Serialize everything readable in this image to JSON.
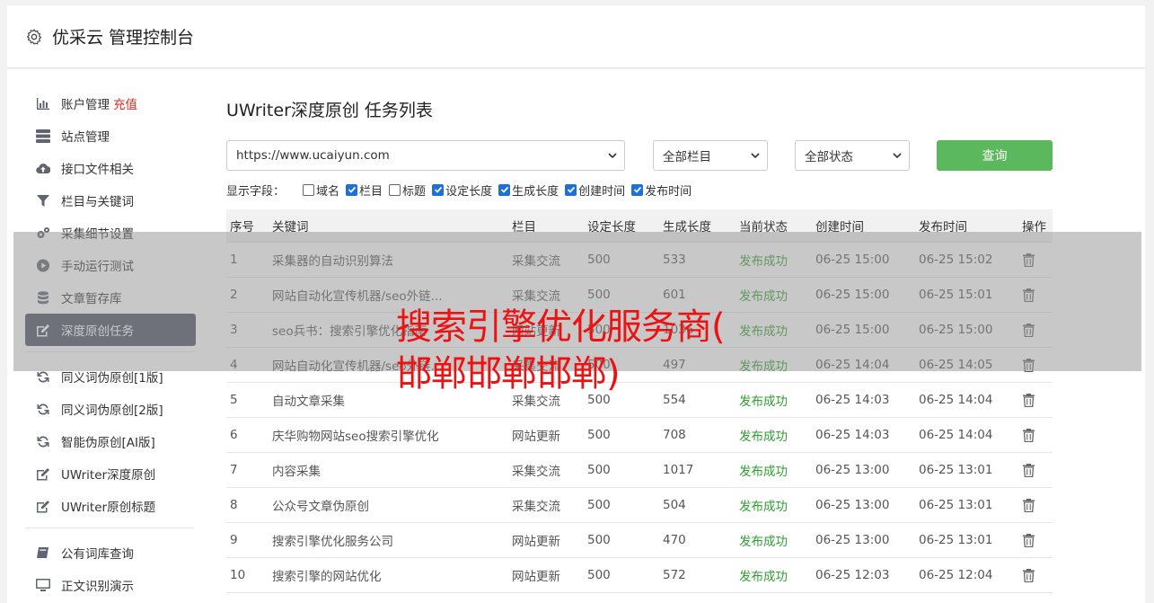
{
  "header": {
    "title": "优采云 管理控制台",
    "icon": "gear-icon"
  },
  "sidebar": {
    "group1": [
      {
        "label": "账户管理",
        "extra": "充值",
        "icon": "bar-chart-icon"
      },
      {
        "label": "站点管理",
        "icon": "server-icon"
      },
      {
        "label": "接口文件相关",
        "icon": "cloud-upload-icon"
      },
      {
        "label": "栏目与关键词",
        "icon": "filter-icon"
      },
      {
        "label": "采集细节设置",
        "icon": "gears-icon"
      },
      {
        "label": "手动运行测试",
        "icon": "play-circle-icon"
      },
      {
        "label": "文章暂存库",
        "icon": "database-icon"
      },
      {
        "label": "深度原创任务",
        "icon": "edit-icon",
        "active": true
      }
    ],
    "group2": [
      {
        "label": "同义词伪原创[1版]",
        "icon": "refresh-icon"
      },
      {
        "label": "同义词伪原创[2版]",
        "icon": "refresh-icon"
      },
      {
        "label": "智能伪原创[AI版]",
        "icon": "refresh-icon"
      },
      {
        "label": "UWriter深度原创",
        "icon": "edit-icon"
      },
      {
        "label": "UWriter原创标题",
        "icon": "edit-icon"
      }
    ],
    "group3": [
      {
        "label": "公有词库查询",
        "icon": "book-icon"
      },
      {
        "label": "正文识别演示",
        "icon": "monitor-icon"
      }
    ]
  },
  "main": {
    "title": "UWriter深度原创 任务列表",
    "site_select": "https://www.ucaiyun.com",
    "column_select": "全部栏目",
    "status_select": "全部状态",
    "query_button": "查询",
    "fields_label": "显示字段：",
    "fields": [
      {
        "label": "域名",
        "checked": false
      },
      {
        "label": "栏目",
        "checked": true
      },
      {
        "label": "标题",
        "checked": false
      },
      {
        "label": "设定长度",
        "checked": true
      },
      {
        "label": "生成长度",
        "checked": true
      },
      {
        "label": "创建时间",
        "checked": true
      },
      {
        "label": "发布时间",
        "checked": true
      }
    ],
    "columns": [
      "序号",
      "关键词",
      "栏目",
      "设定长度",
      "生成长度",
      "当前状态",
      "创建时间",
      "发布时间",
      "操作"
    ],
    "rows": [
      [
        "1",
        "采集器的自动识别算法",
        "采集交流",
        "500",
        "533",
        "发布成功",
        "06-25 15:00",
        "06-25 15:02"
      ],
      [
        "2",
        "网站自动化宣传机器/seo外链...",
        "采集交流",
        "500",
        "601",
        "发布成功",
        "06-25 15:00",
        "06-25 15:01"
      ],
      [
        "3",
        "seo兵书：搜索引擎优化指南",
        "网站更新",
        "500",
        "1036",
        "发布成功",
        "06-25 15:00",
        "06-25 15:00"
      ],
      [
        "4",
        "网站自动化宣传机器/seo外链...",
        "采集交流",
        "500",
        "497",
        "发布成功",
        "06-25 14:04",
        "06-25 14:05"
      ],
      [
        "5",
        "自动文章采集",
        "采集交流",
        "500",
        "554",
        "发布成功",
        "06-25 14:03",
        "06-25 14:04"
      ],
      [
        "6",
        "庆华购物网站seo搜索引擎优化",
        "网站更新",
        "500",
        "708",
        "发布成功",
        "06-25 14:03",
        "06-25 14:04"
      ],
      [
        "7",
        "内容采集",
        "采集交流",
        "500",
        "1017",
        "发布成功",
        "06-25 13:00",
        "06-25 13:01"
      ],
      [
        "8",
        "公众号文章伪原创",
        "采集交流",
        "500",
        "504",
        "发布成功",
        "06-25 13:00",
        "06-25 13:01"
      ],
      [
        "9",
        "搜索引擎优化服务公司",
        "网站更新",
        "500",
        "470",
        "发布成功",
        "06-25 13:00",
        "06-25 13:01"
      ],
      [
        "10",
        "搜索引擎的网站优化",
        "网站更新",
        "500",
        "572",
        "发布成功",
        "06-25 12:03",
        "06-25 12:04"
      ]
    ]
  },
  "watermark": {
    "line1": "搜索引擎优化服务商(",
    "line2": "邯郸邯郸邯郸)"
  },
  "colors": {
    "active_menu": "#4b5062",
    "query_button": "#5cb85c",
    "status_ok": "#2f9e2f",
    "recharge": "#e0281f",
    "watermark": "#ee1111"
  }
}
